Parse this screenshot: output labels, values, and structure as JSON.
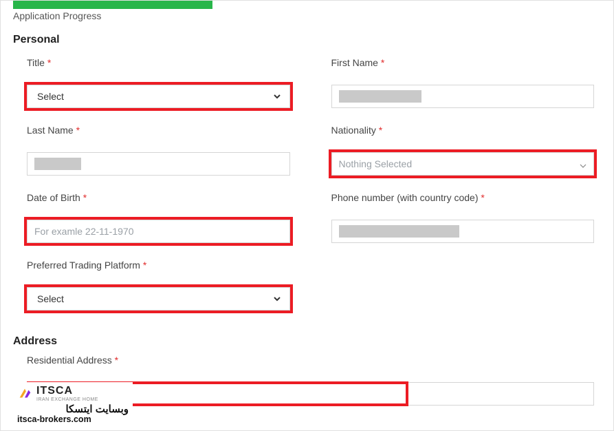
{
  "progress": {
    "label": "Application Progress"
  },
  "sections": {
    "personal": "Personal",
    "address": "Address"
  },
  "fields": {
    "title": {
      "label": "Title",
      "req": "*",
      "select": "Select"
    },
    "firstName": {
      "label": "First Name",
      "req": "*"
    },
    "lastName": {
      "label": "Last Name",
      "req": "*"
    },
    "nationality": {
      "label": "Nationality",
      "req": "*",
      "placeholder": "Nothing Selected"
    },
    "dob": {
      "label": "Date of Birth",
      "req": "*",
      "placeholder": "For examle 22-11-1970"
    },
    "phone": {
      "label": "Phone number (with country code)",
      "req": "*"
    },
    "platform": {
      "label": "Preferred Trading Platform",
      "req": "*",
      "select": "Select"
    },
    "residential": {
      "label": "Residential Address",
      "req": "*"
    }
  },
  "watermark": {
    "brand": "ITSCA",
    "sub": "IRAN EXCHANGE HOME",
    "fa": "وبسایت ایتسکا",
    "url": "itsca-brokers.com"
  }
}
